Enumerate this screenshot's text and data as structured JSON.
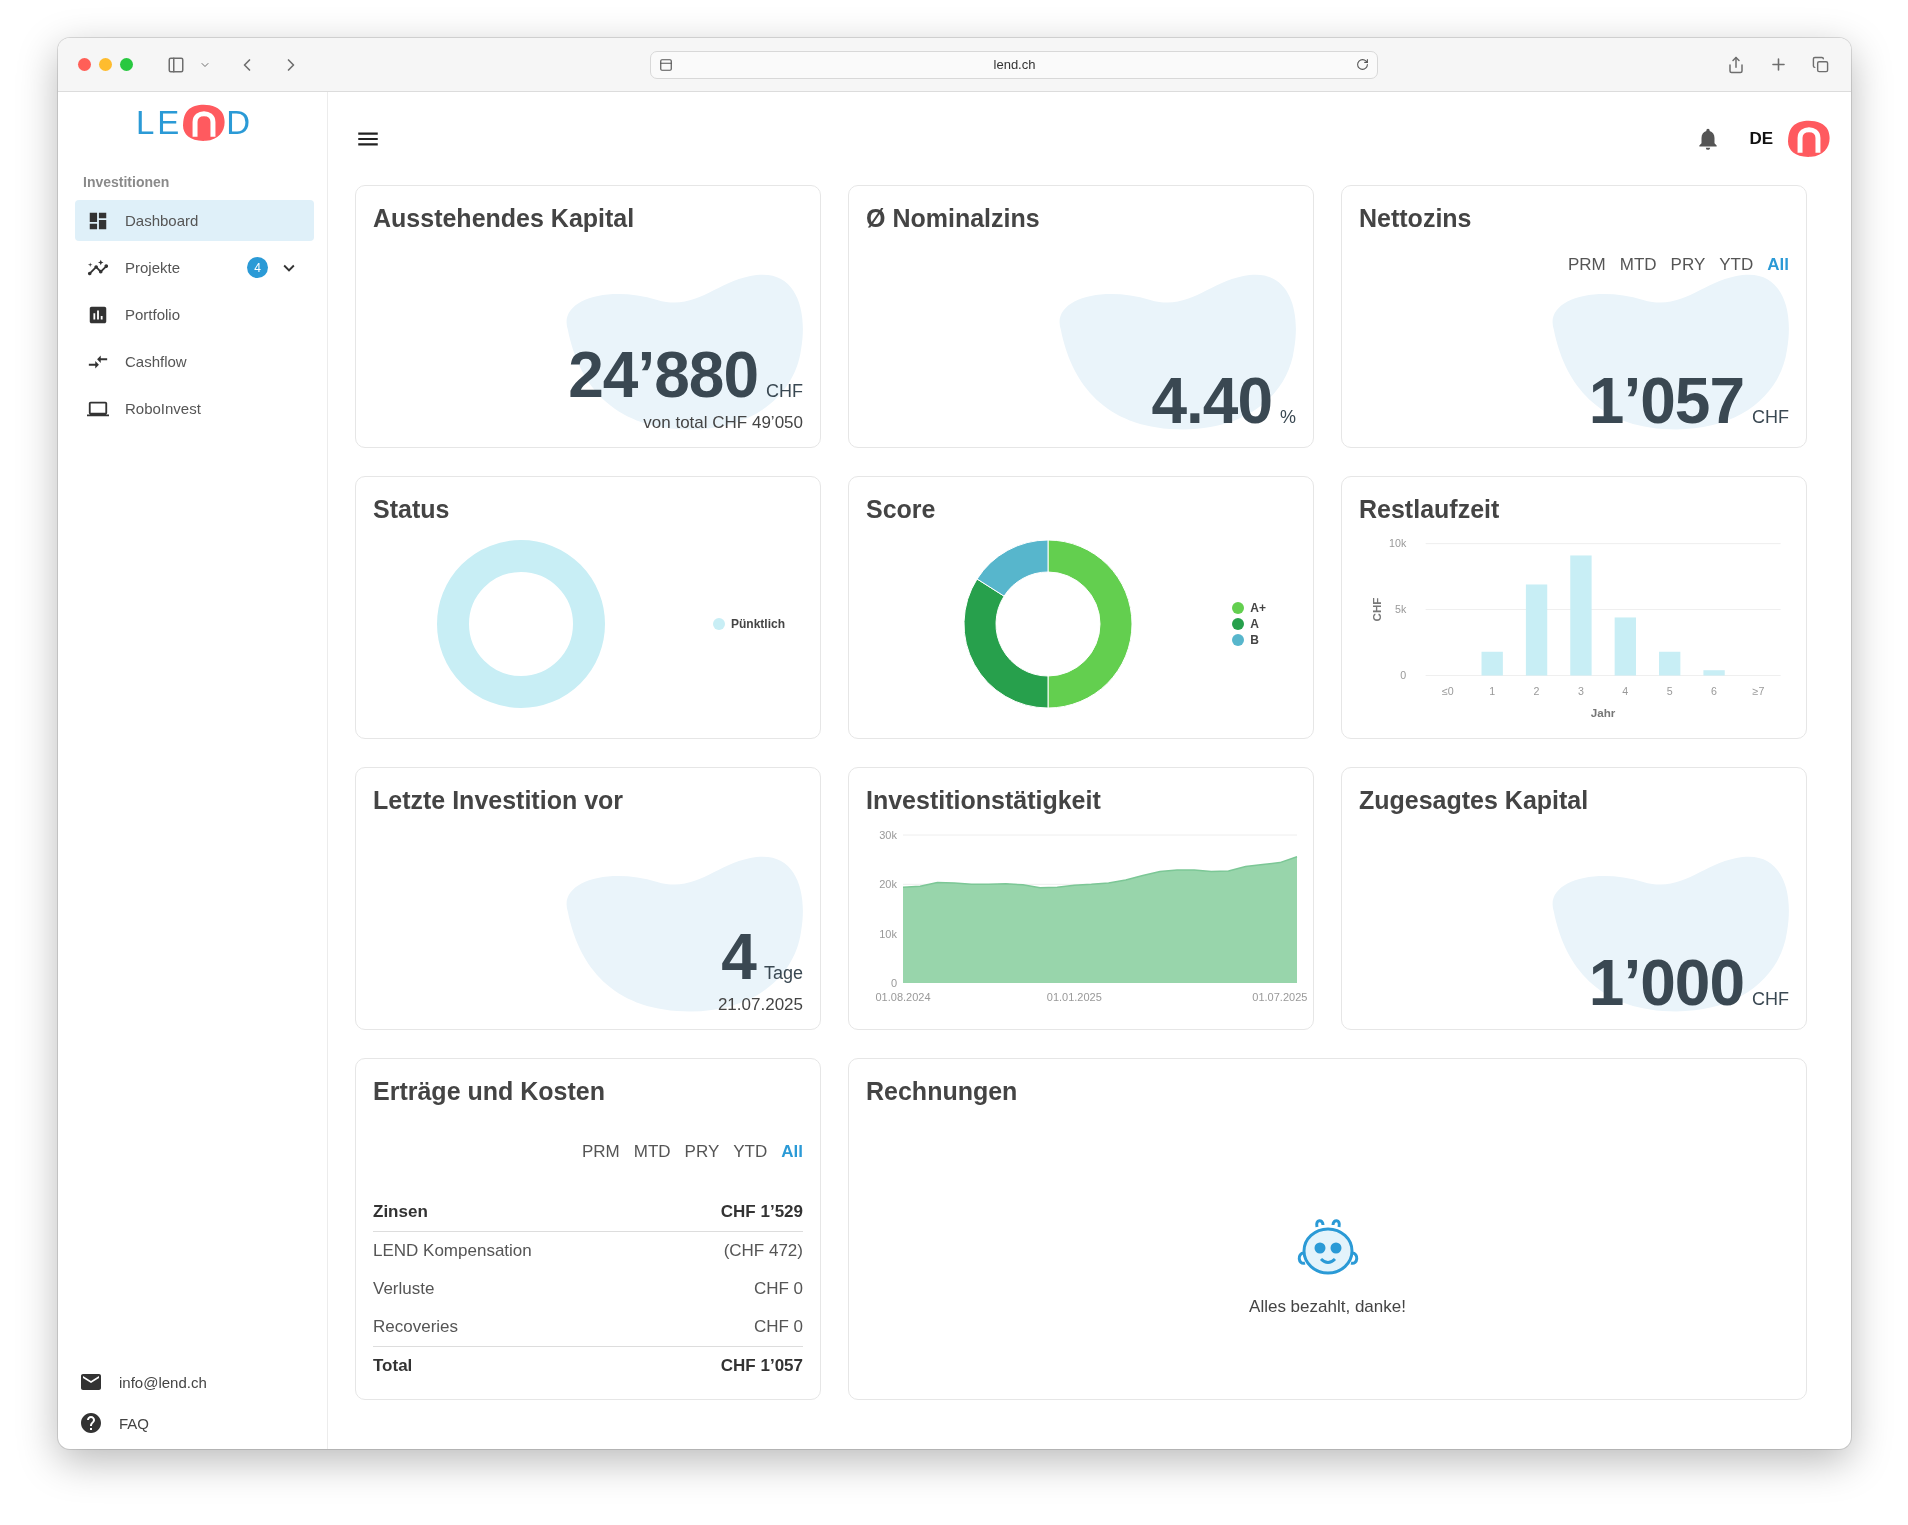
{
  "browser": {
    "url": "lend.ch"
  },
  "logo": {
    "text_start": "LE",
    "text_end": "D"
  },
  "sidebar": {
    "section": "Investitionen",
    "items": [
      {
        "label": "Dashboard",
        "selected": true
      },
      {
        "label": "Projekte",
        "selected": false,
        "badge": "4",
        "expanded": false
      },
      {
        "label": "Portfolio",
        "selected": false
      },
      {
        "label": "Cashflow",
        "selected": false
      },
      {
        "label": "RoboInvest",
        "selected": false
      }
    ],
    "footer": [
      {
        "label": "info@lend.ch"
      },
      {
        "label": "FAQ"
      }
    ]
  },
  "header": {
    "language": "DE"
  },
  "cards": [
    {
      "kind": "kpi",
      "title": "Ausstehendes Kapital",
      "value": "24’880",
      "unit": "CHF",
      "note": "von total CHF 49’050"
    },
    {
      "kind": "kpi",
      "title": "Ø Nominalzins",
      "value": "4.40",
      "unit": "%"
    },
    {
      "kind": "kpi",
      "title": "Nettozins",
      "value": "1’057",
      "unit": "CHF",
      "periods": [
        {
          "label": "PRM",
          "selected": false
        },
        {
          "label": "MTD",
          "selected": false
        },
        {
          "label": "PRY",
          "selected": false
        },
        {
          "label": "YTD",
          "selected": false
        },
        {
          "label": "All",
          "selected": true
        }
      ]
    },
    {
      "kind": "ring",
      "title": "Status",
      "legend": [
        {
          "label": "Pünktlich",
          "color": "#c8eef5"
        }
      ]
    },
    {
      "kind": "chart",
      "title": "Score",
      "legend": [
        {
          "label": "A+",
          "color": "#63cf4f"
        },
        {
          "label": "A",
          "color": "#27a04c"
        },
        {
          "label": "B",
          "color": "#57b6cc"
        }
      ],
      "chart_data": {
        "type": "donut",
        "values": [
          0.5,
          0.34,
          0.16
        ]
      }
    },
    {
      "kind": "chart",
      "title": "Restlaufzeit",
      "chart_data": {
        "type": "bar",
        "xlabel": "Jahr",
        "ylabel": "CHF",
        "categories": [
          "≤0",
          "1",
          "2",
          "3",
          "4",
          "5",
          "6",
          "≥7"
        ],
        "values": [
          0,
          1800,
          6900,
          9100,
          4400,
          1800,
          400,
          0
        ],
        "ylim": [
          0,
          10000
        ],
        "yticks": [
          {
            "value": 0,
            "label": "0"
          },
          {
            "value": 5000,
            "label": "5k"
          },
          {
            "value": 10000,
            "label": "10k"
          }
        ]
      }
    },
    {
      "kind": "kpi",
      "title": "Letzte Investition vor",
      "value": "4",
      "unit": "Tage",
      "note": "21.07.2025"
    },
    {
      "kind": "chart",
      "title": "Investitionstätigkeit",
      "chart_data": {
        "type": "area",
        "categories": [
          "01.08.2024",
          null,
          null,
          null,
          null,
          null,
          null,
          null,
          null,
          null,
          "01.01.2025",
          null,
          null,
          null,
          null,
          null,
          null,
          null,
          null,
          null,
          null,
          null,
          "01.07.2025",
          null
        ],
        "ylim": [
          0,
          30000
        ],
        "yticks": [
          {
            "value": 0,
            "label": "0"
          },
          {
            "value": 10000,
            "label": "10k"
          },
          {
            "value": 20000,
            "label": "20k"
          },
          {
            "value": 30000,
            "label": "30k"
          }
        ],
        "series": [
          {
            "values": [
              19400,
              19600,
              20400,
              20300,
              20000,
              20000,
              20100,
              19900,
              19300,
              19400,
              19800,
              20000,
              20300,
              20900,
              21800,
              22600,
              22900,
              22900,
              22600,
              22700,
              23600,
              24000,
              24400,
              25600
            ]
          }
        ]
      }
    },
    {
      "kind": "kpi",
      "title": "Zugesagtes Kapital",
      "value": "1’000",
      "unit": "CHF"
    },
    {
      "kind": "table",
      "title": "Erträge und Kosten",
      "periods": [
        {
          "label": "PRM",
          "selected": false
        },
        {
          "label": "MTD",
          "selected": false
        },
        {
          "label": "PRY",
          "selected": false
        },
        {
          "label": "YTD",
          "selected": false
        },
        {
          "label": "All",
          "selected": true
        }
      ],
      "rows": [
        {
          "label": "Zinsen",
          "value": "CHF 1’529",
          "kind": "subtotal"
        },
        {
          "label": "LEND Kompensation",
          "value": "(CHF 472)",
          "kind": "item"
        },
        {
          "label": "Verluste",
          "value": "CHF 0",
          "kind": "item"
        },
        {
          "label": "Recoveries",
          "value": "CHF 0",
          "kind": "item"
        },
        {
          "label": "Total",
          "value": "CHF 1’057",
          "kind": "total"
        }
      ]
    },
    {
      "kind": "empty",
      "title": "Rechnungen",
      "message": "Alles bezahlt, danke!"
    }
  ]
}
